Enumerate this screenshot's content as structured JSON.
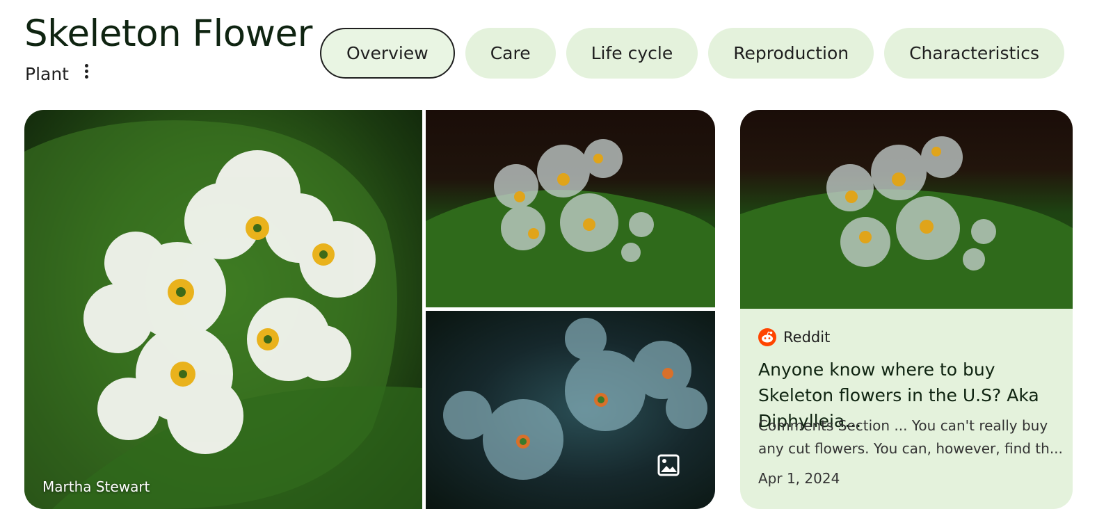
{
  "entity": {
    "title": "Skeleton Flower",
    "type": "Plant",
    "more_icon": "more-vert-icon"
  },
  "tabs": [
    {
      "label": "Overview",
      "active": true
    },
    {
      "label": "Care",
      "active": false
    },
    {
      "label": "Life cycle",
      "active": false
    },
    {
      "label": "Reproduction",
      "active": false
    },
    {
      "label": "Characteristics",
      "active": false
    }
  ],
  "gallery": {
    "main_credit": "Martha Stewart",
    "image_icon": "image-icon"
  },
  "card": {
    "source": "Reddit",
    "source_icon": "reddit-icon",
    "title": "Anyone know where to buy Skeleton flowers in the U.S? Aka Diphylleia...",
    "snippet": "Comments Section ... You can't really buy any cut flowers. You can, however, find th...",
    "date": "Apr 1, 2024"
  },
  "colors": {
    "chip_bg": "#e4f2dc",
    "title": "#0f2411",
    "reddit": "#ff4500"
  }
}
